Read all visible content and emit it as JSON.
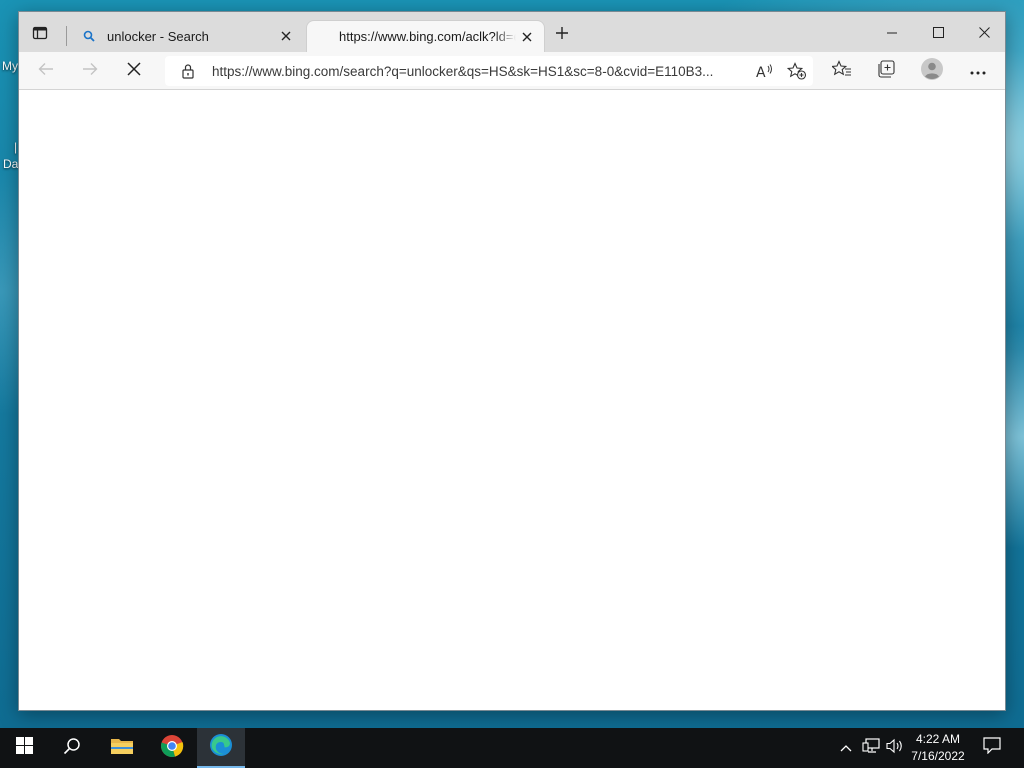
{
  "desktop": {
    "icon_labels": [
      "My",
      "Da"
    ]
  },
  "browser": {
    "tabs": [
      {
        "title": "unlocker - Search",
        "favicon": "search-icon",
        "active": false
      },
      {
        "title": "https://www.bing.com/aclk?ld=e",
        "favicon": "loading",
        "active": true
      }
    ],
    "address_bar": {
      "url": "https://www.bing.com/search?q=unlocker&qs=HS&sk=HS1&sc=8-0&cvid=E110B3..."
    },
    "toolbar_icons": [
      "back-icon",
      "forward-icon",
      "stop-icon",
      "read-aloud-icon",
      "add-favorite-icon",
      "favorites-icon",
      "collections-icon",
      "profile-icon",
      "more-icon"
    ],
    "accent_color": "#1a73c8"
  },
  "taskbar": {
    "apps": [
      "start-icon",
      "search-icon",
      "file-explorer-icon",
      "chrome-icon",
      "edge-icon"
    ],
    "clock": {
      "time": "4:22 AM",
      "date": "7/16/2022"
    }
  }
}
